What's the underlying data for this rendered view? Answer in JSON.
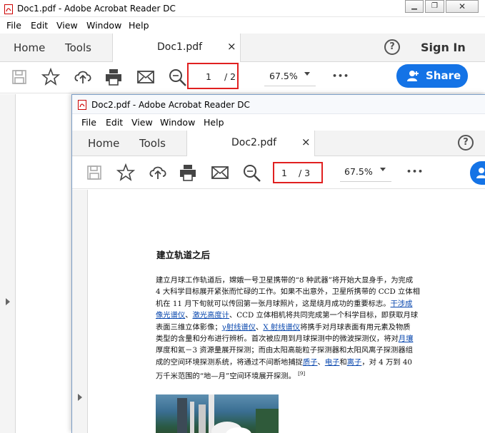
{
  "window1": {
    "title": "Doc1.pdf - Adobe Acrobat Reader DC",
    "menu": [
      "File",
      "Edit",
      "View",
      "Window",
      "Help"
    ],
    "nav": {
      "home": "Home",
      "tools": "Tools"
    },
    "tab": {
      "label": "Doc1.pdf",
      "close": "×"
    },
    "help": "?",
    "sign_in": "Sign In",
    "page": {
      "current": "1",
      "total": "/ 2"
    },
    "zoom": "67.5%",
    "more": "•••",
    "share": "Share"
  },
  "window2": {
    "title": "Doc2.pdf - Adobe Acrobat Reader DC",
    "menu": [
      "File",
      "Edit",
      "View",
      "Window",
      "Help"
    ],
    "nav": {
      "home": "Home",
      "tools": "Tools"
    },
    "tab": {
      "label": "Doc2.pdf",
      "close": "×"
    },
    "help": "?",
    "page": {
      "current": "1",
      "total": "/ 3"
    },
    "zoom": "67.5%",
    "more": "•••"
  },
  "document": {
    "heading": "建立轨道之后",
    "lines": {
      "l1": "建立月球工作轨道后，嫦娥一号卫星携带的“8 种武器”将开始大显身手，为完成",
      "l2": "4 大科学目标展开紧张而忙碌的工作。如果不出意外，卫星所携带的 CCD 立体相",
      "l3a": "机在 11 月下旬就可以传回第一张月球照片，这是绕月成功的重要标志。",
      "l3b": "干涉成",
      "l4a": "像光谱仪",
      "l4b": "、",
      "l4c": "激光高度计",
      "l4d": "、CCD 立体相机将共同完成第一个科学目标，即获取月球",
      "l5a": "表面三维立体影像；",
      "l5b": "γ射线谱仪",
      "l5c": "、",
      "l5d": "X 射线谱仪",
      "l5e": "将携手对月球表面有用元素及物质",
      "l6a": "类型的含量和分布进行辨析。首次被应用到月球探测中的微波探测仪，将对",
      "l6b": "月壤",
      "l7": "厚度和氦－3 资源量展开探测；而由太阳高能粒子探测器和太阳风离子探测器组",
      "l8a": "成的空间环境探测系统，将通过不间断地捕捉",
      "l8b": "质子",
      "l8c": "、",
      "l8d": "电子",
      "l8e": "和",
      "l8f": "离子",
      "l8g": "，对 4 万到 40",
      "l9": "万千米范围的“地—月”空间环境展开探测。",
      "footnote": "[9]"
    }
  },
  "colors": {
    "accent": "#1473e6",
    "highlight_box": "#e02020",
    "link": "#0645ad"
  }
}
